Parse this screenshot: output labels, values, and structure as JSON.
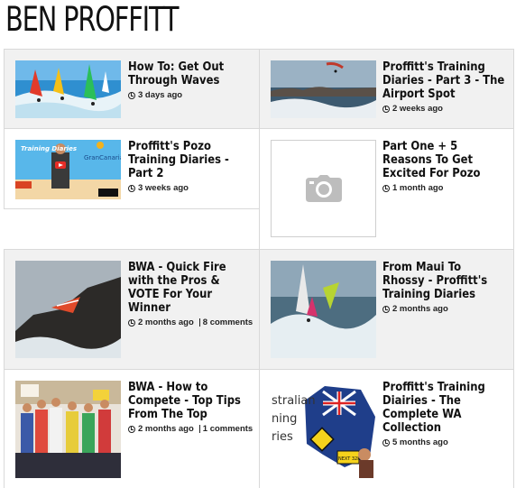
{
  "page": {
    "title": "BEN PROFFITT"
  },
  "articles": [
    {
      "title": "How To: Get Out Through Waves",
      "time": "3 days ago",
      "comments": null,
      "thumb": "windsurf-waves-sequence"
    },
    {
      "title": "Proffitt's Training Diaries - Part 3 - The Airport Spot",
      "time": "2 weeks ago",
      "comments": null,
      "thumb": "kite-jump-ocean"
    },
    {
      "title": "Proffitt's Pozo Training Diaries - Part 2",
      "time": "3 weeks ago",
      "comments": null,
      "thumb": "video-still-gran-canaria"
    },
    {
      "title": "Part One + 5 Reasons To Get Excited For Pozo",
      "time": "1 month ago",
      "comments": null,
      "thumb": "camera-icon"
    },
    {
      "title": "BWA - Quick Fire with the Pros & VOTE For Your Winner",
      "time": "2 months ago",
      "comments": "8 comments",
      "thumb": "windsurf-rocky-coast"
    },
    {
      "title": "From Maui To Rhossy - Proffitt's Training Diaries",
      "time": "2 months ago",
      "comments": null,
      "thumb": "windsurf-wave-ride"
    },
    {
      "title": "BWA - How to Compete - Top Tips From The Top",
      "time": "2 months ago",
      "comments": "1 comments",
      "thumb": "podium-group-photo"
    },
    {
      "title": "Proffitt's Training Diairies - The Complete WA Collection",
      "time": "5 months ago",
      "comments": null,
      "thumb": "australian-training-diaries"
    }
  ],
  "thumb_text": {
    "video_logo": "GranCanaria",
    "video_caption": "Training Diaries",
    "aus_line1": "stralian",
    "aus_line2": "ning",
    "aus_line3": "ries",
    "aus_sign": "NEXT 32km"
  }
}
